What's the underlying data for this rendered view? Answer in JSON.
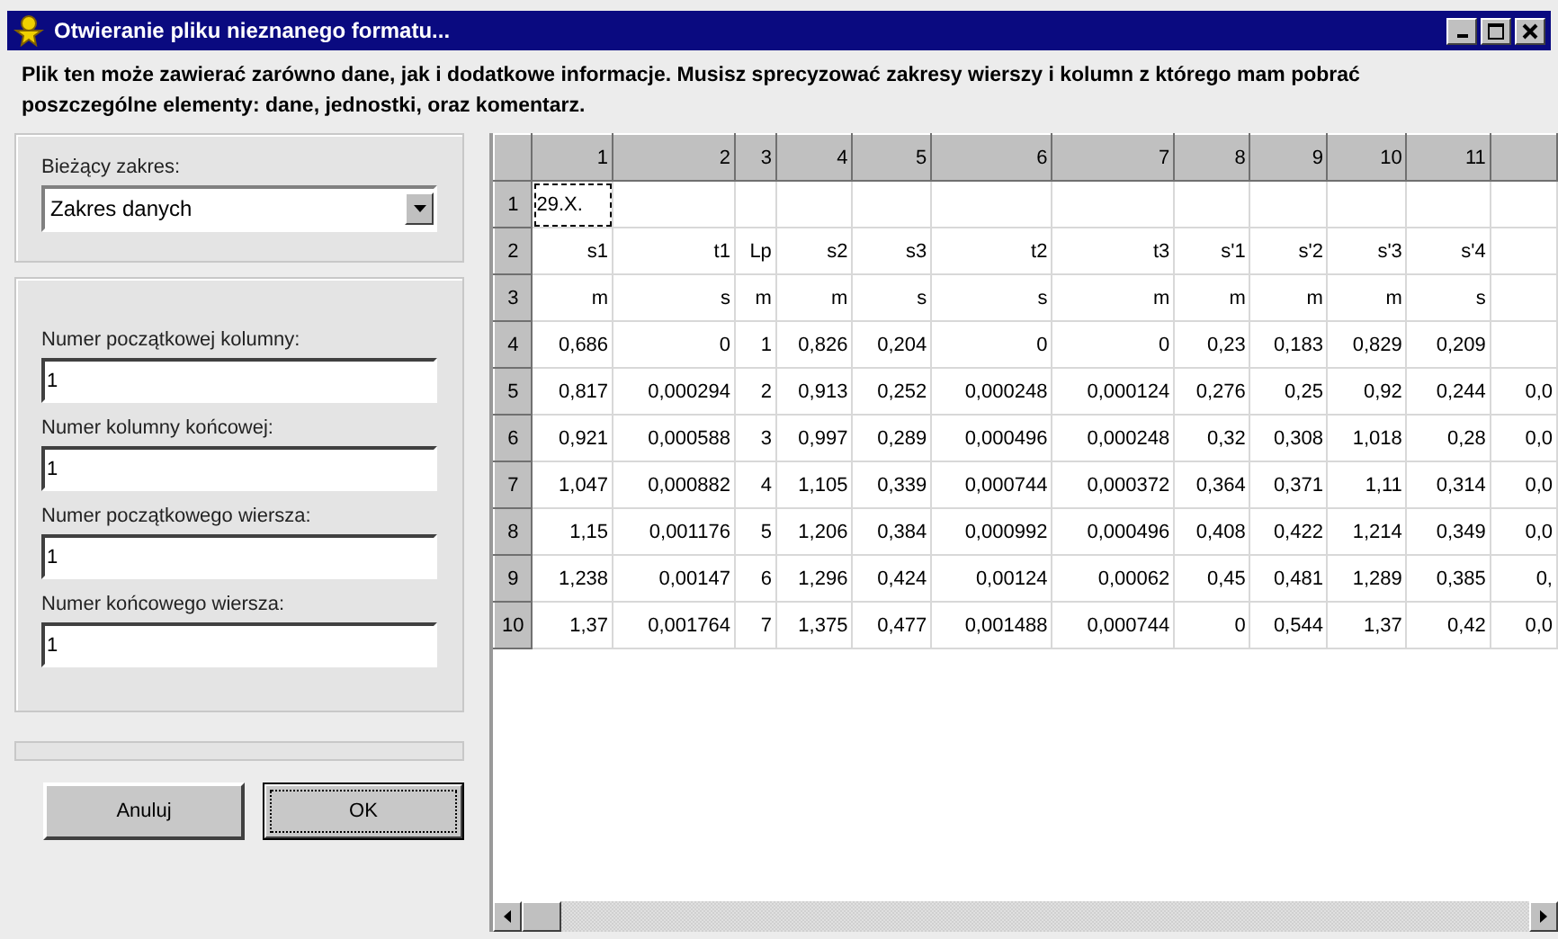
{
  "window": {
    "title": "Otwieranie pliku nieznanego formatu..."
  },
  "description": "Plik ten może zawierać zarówno dane, jak i dodatkowe informacje. Musisz sprecyzować zakresy wierszy i kolumn z którego mam pobrać poszczególne elementy: dane, jednostki, oraz komentarz.",
  "range": {
    "label": "Bieżący zakres:",
    "value": "Zakres danych"
  },
  "fields": [
    {
      "label": "Numer początkowej kolumny:",
      "value": "1"
    },
    {
      "label": "Numer kolumny końcowej:",
      "value": "1"
    },
    {
      "label": "Numer początkowego wiersza:",
      "value": "1"
    },
    {
      "label": "Numer końcowego wiersza:",
      "value": "1"
    }
  ],
  "buttons": [
    {
      "label": "Anuluj",
      "default": false
    },
    {
      "label": "OK",
      "default": true
    }
  ],
  "table": {
    "columns": [
      "1",
      "2",
      "3",
      "4",
      "5",
      "6",
      "7",
      "8",
      "9",
      "10",
      "11",
      null
    ],
    "rows": [
      {
        "header": "1",
        "cells": [
          {
            "text": "29.X.",
            "focused": true
          },
          {
            "focused": false
          },
          {
            "focused": false
          },
          {
            "focused": false
          },
          {
            "focused": false
          },
          {
            "focused": false
          },
          {
            "focused": false
          },
          {
            "focused": false
          },
          {
            "focused": false
          },
          {
            "focused": false
          },
          {
            "focused": false
          },
          {
            "focused": false
          }
        ]
      },
      {
        "header": "2",
        "cells": [
          {
            "text": "s1",
            "focused": false
          },
          {
            "text": "t1",
            "focused": false
          },
          {
            "text": "Lp",
            "focused": false
          },
          {
            "text": "s2",
            "focused": false
          },
          {
            "text": "s3",
            "focused": false
          },
          {
            "text": "t2",
            "focused": false
          },
          {
            "text": "t3",
            "focused": false
          },
          {
            "text": "s'1",
            "focused": false
          },
          {
            "text": "s'2",
            "focused": false
          },
          {
            "text": "s'3",
            "focused": false
          },
          {
            "text": "s'4",
            "focused": false
          },
          {
            "focused": false
          }
        ]
      },
      {
        "header": "3",
        "cells": [
          {
            "text": "m",
            "focused": false
          },
          {
            "text": "s",
            "focused": false
          },
          {
            "text": "m",
            "focused": false
          },
          {
            "text": "m",
            "focused": false
          },
          {
            "text": "s",
            "focused": false
          },
          {
            "text": "s",
            "focused": false
          },
          {
            "text": "m",
            "focused": false
          },
          {
            "text": "m",
            "focused": false
          },
          {
            "text": "m",
            "focused": false
          },
          {
            "text": "m",
            "focused": false
          },
          {
            "text": "s",
            "focused": false
          },
          {
            "focused": false
          }
        ]
      },
      {
        "header": "4",
        "cells": [
          {
            "text": "0,686",
            "focused": false
          },
          {
            "text": "0",
            "focused": false
          },
          {
            "text": "1",
            "focused": false
          },
          {
            "text": "0,826",
            "focused": false
          },
          {
            "text": "0,204",
            "focused": false
          },
          {
            "text": "0",
            "focused": false
          },
          {
            "text": "0",
            "focused": false
          },
          {
            "text": "0,23",
            "focused": false
          },
          {
            "text": "0,183",
            "focused": false
          },
          {
            "text": "0,829",
            "focused": false
          },
          {
            "text": "0,209",
            "focused": false
          },
          {
            "focused": false
          }
        ]
      },
      {
        "header": "5",
        "cells": [
          {
            "text": "0,817",
            "focused": false
          },
          {
            "text": "0,000294",
            "focused": false
          },
          {
            "text": "2",
            "focused": false
          },
          {
            "text": "0,913",
            "focused": false
          },
          {
            "text": "0,252",
            "focused": false
          },
          {
            "text": "0,000248",
            "focused": false
          },
          {
            "text": "0,000124",
            "focused": false
          },
          {
            "text": "0,276",
            "focused": false
          },
          {
            "text": "0,25",
            "focused": false
          },
          {
            "text": "0,92",
            "focused": false
          },
          {
            "text": "0,244",
            "focused": false
          },
          {
            "text": "0,0",
            "focused": false
          }
        ]
      },
      {
        "header": "6",
        "cells": [
          {
            "text": "0,921",
            "focused": false
          },
          {
            "text": "0,000588",
            "focused": false
          },
          {
            "text": "3",
            "focused": false
          },
          {
            "text": "0,997",
            "focused": false
          },
          {
            "text": "0,289",
            "focused": false
          },
          {
            "text": "0,000496",
            "focused": false
          },
          {
            "text": "0,000248",
            "focused": false
          },
          {
            "text": "0,32",
            "focused": false
          },
          {
            "text": "0,308",
            "focused": false
          },
          {
            "text": "1,018",
            "focused": false
          },
          {
            "text": "0,28",
            "focused": false
          },
          {
            "text": "0,0",
            "focused": false
          }
        ]
      },
      {
        "header": "7",
        "cells": [
          {
            "text": "1,047",
            "focused": false
          },
          {
            "text": "0,000882",
            "focused": false
          },
          {
            "text": "4",
            "focused": false
          },
          {
            "text": "1,105",
            "focused": false
          },
          {
            "text": "0,339",
            "focused": false
          },
          {
            "text": "0,000744",
            "focused": false
          },
          {
            "text": "0,000372",
            "focused": false
          },
          {
            "text": "0,364",
            "focused": false
          },
          {
            "text": "0,371",
            "focused": false
          },
          {
            "text": "1,11",
            "focused": false
          },
          {
            "text": "0,314",
            "focused": false
          },
          {
            "text": "0,0",
            "focused": false
          }
        ]
      },
      {
        "header": "8",
        "cells": [
          {
            "text": "1,15",
            "focused": false
          },
          {
            "text": "0,001176",
            "focused": false
          },
          {
            "text": "5",
            "focused": false
          },
          {
            "text": "1,206",
            "focused": false
          },
          {
            "text": "0,384",
            "focused": false
          },
          {
            "text": "0,000992",
            "focused": false
          },
          {
            "text": "0,000496",
            "focused": false
          },
          {
            "text": "0,408",
            "focused": false
          },
          {
            "text": "0,422",
            "focused": false
          },
          {
            "text": "1,214",
            "focused": false
          },
          {
            "text": "0,349",
            "focused": false
          },
          {
            "text": "0,0",
            "focused": false
          }
        ]
      },
      {
        "header": "9",
        "cells": [
          {
            "text": "1,238",
            "focused": false
          },
          {
            "text": "0,00147",
            "focused": false
          },
          {
            "text": "6",
            "focused": false
          },
          {
            "text": "1,296",
            "focused": false
          },
          {
            "text": "0,424",
            "focused": false
          },
          {
            "text": "0,00124",
            "focused": false
          },
          {
            "text": "0,00062",
            "focused": false
          },
          {
            "text": "0,45",
            "focused": false
          },
          {
            "text": "0,481",
            "focused": false
          },
          {
            "text": "1,289",
            "focused": false
          },
          {
            "text": "0,385",
            "focused": false
          },
          {
            "text": "0,",
            "focused": false
          }
        ]
      },
      {
        "header": "10",
        "cells": [
          {
            "text": "1,37",
            "focused": false
          },
          {
            "text": "0,001764",
            "focused": false
          },
          {
            "text": "7",
            "focused": false
          },
          {
            "text": "1,375",
            "focused": false
          },
          {
            "text": "0,477",
            "focused": false
          },
          {
            "text": "0,001488",
            "focused": false
          },
          {
            "text": "0,000744",
            "focused": false
          },
          {
            "text": "0",
            "focused": false
          },
          {
            "text": "0,544",
            "focused": false
          },
          {
            "text": "1,37",
            "focused": false
          },
          {
            "text": "0,42",
            "focused": false
          },
          {
            "text": "0,0",
            "focused": false
          }
        ]
      }
    ]
  }
}
